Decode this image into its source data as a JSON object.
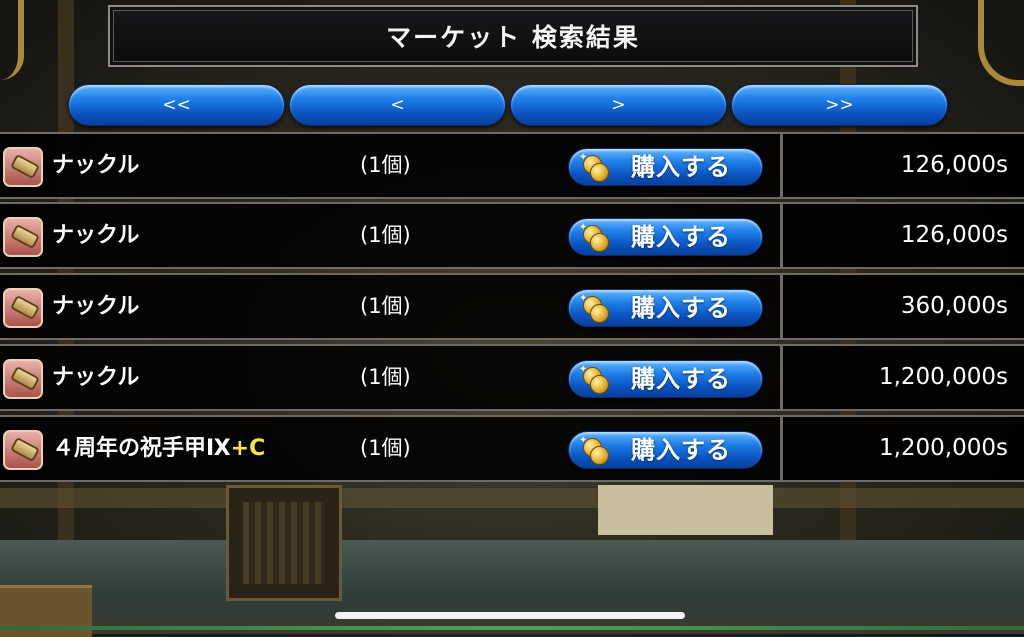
{
  "header": {
    "title": "マーケット 検索結果"
  },
  "pagination": [
    {
      "label": "<<"
    },
    {
      "label": "<"
    },
    {
      "label": ">"
    },
    {
      "label": ">>"
    }
  ],
  "items": [
    {
      "name": "ナックル",
      "suffix": "",
      "quantity": "(1個)",
      "buy_label": "購入する",
      "price": "126,000s",
      "icon": "knuckle-icon"
    },
    {
      "name": "ナックル",
      "suffix": "",
      "quantity": "(1個)",
      "buy_label": "購入する",
      "price": "126,000s",
      "icon": "knuckle-icon"
    },
    {
      "name": "ナックル",
      "suffix": "",
      "quantity": "(1個)",
      "buy_label": "購入する",
      "price": "360,000s",
      "icon": "knuckle-icon"
    },
    {
      "name": "ナックル",
      "suffix": "",
      "quantity": "(1個)",
      "buy_label": "購入する",
      "price": "1,200,000s",
      "icon": "knuckle-icon"
    },
    {
      "name": "４周年の祝手甲Ⅸ",
      "suffix": "+C",
      "quantity": "(1個)",
      "buy_label": "購入する",
      "price": "1,200,000s",
      "icon": "knuckle-icon"
    }
  ],
  "colors": {
    "button_blue": "#1f7fe8",
    "suffix_yellow": "#f2e64b",
    "row_border": "#6f6a64"
  }
}
